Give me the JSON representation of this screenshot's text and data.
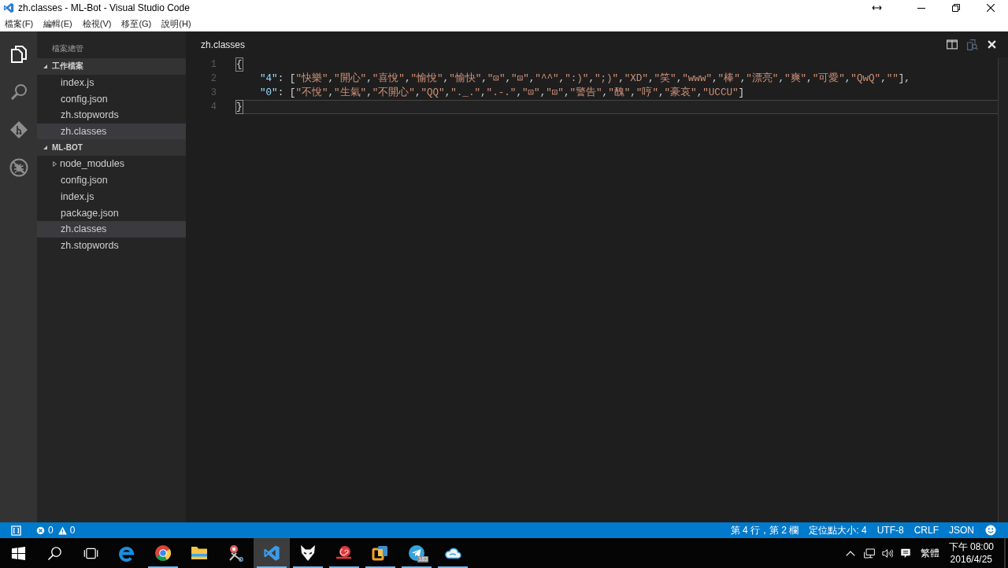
{
  "window": {
    "title": "zh.classes - ML-Bot - Visual Studio Code"
  },
  "menu": [
    "檔案(F)",
    "編輯(E)",
    "檢視(V)",
    "移至(G)",
    "說明(H)"
  ],
  "activity_bar": [
    {
      "kind": "files",
      "selected": true
    },
    {
      "kind": "search",
      "selected": false
    },
    {
      "kind": "git",
      "selected": false
    },
    {
      "kind": "debug",
      "selected": false
    }
  ],
  "sidebar": {
    "title": "檔案總管",
    "sections": [
      {
        "label": "工作檔案",
        "expanded": true,
        "items": [
          {
            "label": "index.js",
            "kind": "file",
            "selected": false
          },
          {
            "label": "config.json",
            "kind": "file",
            "selected": false
          },
          {
            "label": "zh.stopwords",
            "kind": "file",
            "selected": false
          },
          {
            "label": "zh.classes",
            "kind": "file",
            "selected": true
          }
        ]
      },
      {
        "label": "ML-BOT",
        "expanded": true,
        "items": [
          {
            "label": "node_modules",
            "kind": "folder",
            "expanded": false,
            "selected": false
          },
          {
            "label": "config.json",
            "kind": "file",
            "selected": false
          },
          {
            "label": "index.js",
            "kind": "file",
            "selected": false
          },
          {
            "label": "package.json",
            "kind": "file",
            "selected": false
          },
          {
            "label": "zh.classes",
            "kind": "file",
            "selected": true
          },
          {
            "label": "zh.stopwords",
            "kind": "file",
            "selected": false
          }
        ]
      }
    ]
  },
  "editor": {
    "tab": "zh.classes",
    "lines": [
      {
        "number": "1",
        "kind": "brace",
        "text": "{",
        "bracket_match": true,
        "current": false
      },
      {
        "number": "2",
        "kind": "entry",
        "key": "\"4\"",
        "colon": ": ",
        "open": "[",
        "values": [
          "\"快樂\"",
          "\"開心\"",
          "\"喜悅\"",
          "\"愉悅\"",
          "\"愉快\"",
          "\"⊡\"",
          "\"⊡\"",
          "\"^^\"",
          "\":)\"",
          "\";)\"",
          "\"XD\"",
          "\"笑\"",
          "\"www\"",
          "\"棒\"",
          "\"漂亮\"",
          "\"爽\"",
          "\"可愛\"",
          "\"QwQ\"",
          "\"\""
        ],
        "separator": ",",
        "close": "]",
        "trailing": ",",
        "current": false
      },
      {
        "number": "3",
        "kind": "entry",
        "key": "\"0\"",
        "colon": ": ",
        "open": "[",
        "values": [
          "\"不悅\"",
          "\"生氣\"",
          "\"不開心\"",
          "\"QQ\"",
          "\"._.\"",
          "\".-.\"",
          "\"⊡\"",
          "\"⊡\"",
          "\"警告\"",
          "\"醜\"",
          "\"哼\"",
          "\"豪哀\"",
          "\"UCCU\""
        ],
        "separator": ",",
        "close": "]",
        "current": false
      },
      {
        "number": "4",
        "kind": "brace",
        "text": "}",
        "bracket_match": true,
        "current": true
      }
    ]
  },
  "status_bar": {
    "errors": "0",
    "warnings": "0",
    "items": [
      "第 4 行，第 2 欄",
      "定位點大小: 4",
      "UTF-8",
      "CRLF",
      "JSON"
    ]
  },
  "taskbar": {
    "buttons": [
      {
        "kind": "start",
        "selected": false,
        "running": false
      },
      {
        "kind": "search",
        "selected": false,
        "running": false
      },
      {
        "kind": "taskview",
        "selected": false,
        "running": false
      },
      {
        "kind": "letter",
        "selected": false,
        "running": false
      },
      {
        "kind": "circle",
        "selected": false,
        "running": true
      },
      {
        "kind": "folder",
        "selected": false,
        "running": false
      },
      {
        "kind": "scissors",
        "selected": false,
        "running": false
      },
      {
        "kind": "ribbon",
        "selected": true,
        "running": true
      },
      {
        "kind": "fox",
        "selected": false,
        "running": true
      },
      {
        "kind": "snail",
        "selected": false,
        "running": true
      },
      {
        "kind": "squares",
        "selected": false,
        "running": true
      },
      {
        "kind": "plane",
        "selected": false,
        "running": true,
        "badge": "183"
      },
      {
        "kind": "cloud",
        "selected": false,
        "running": true
      }
    ],
    "tray": {
      "input_method": "繁體",
      "time": "下午 08:00",
      "date": "2016/4/25"
    }
  }
}
